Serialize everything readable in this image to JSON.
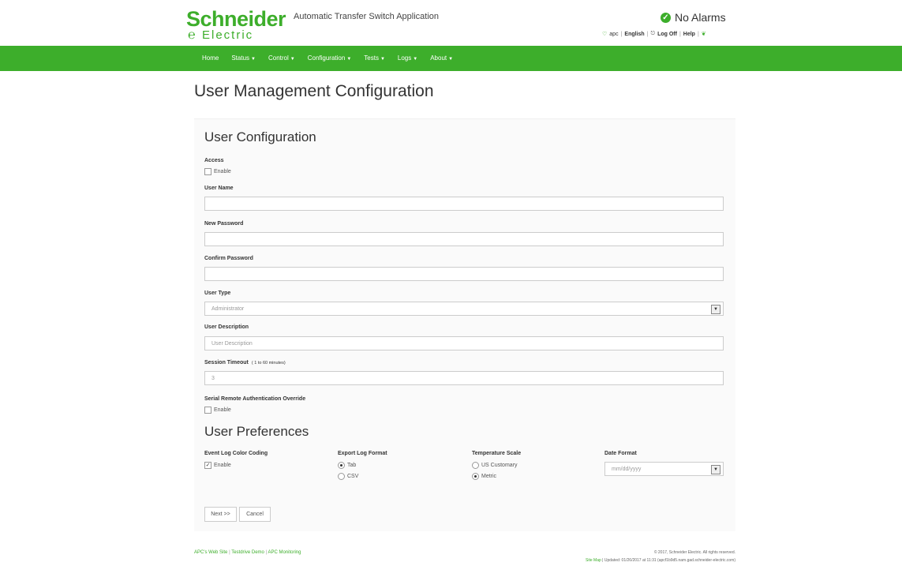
{
  "header": {
    "logo_main": "Schneider",
    "logo_sub": "Electric",
    "app_title": "Automatic Transfer Switch Application",
    "alarm_text": "No Alarms",
    "links": {
      "user": "apc",
      "language": "English",
      "logoff": "Log Off",
      "help": "Help"
    }
  },
  "nav": [
    {
      "label": "Home",
      "dropdown": false
    },
    {
      "label": "Status",
      "dropdown": true
    },
    {
      "label": "Control",
      "dropdown": true
    },
    {
      "label": "Configuration",
      "dropdown": true
    },
    {
      "label": "Tests",
      "dropdown": true
    },
    {
      "label": "Logs",
      "dropdown": true
    },
    {
      "label": "About",
      "dropdown": true
    }
  ],
  "page_title": "User Management Configuration",
  "user_config": {
    "title": "User Configuration",
    "access_label": "Access",
    "access_enable": "Enable",
    "access_checked": false,
    "username_label": "User Name",
    "username_value": "",
    "new_password_label": "New Password",
    "confirm_password_label": "Confirm Password",
    "user_type_label": "User Type",
    "user_type_value": "Administrator",
    "description_label": "User Description",
    "description_placeholder": "User Description",
    "session_timeout_label": "Session Timeout",
    "session_timeout_hint": "( 1 to 60 minutes)",
    "session_timeout_value": "3",
    "serial_override_label": "Serial Remote Authentication Override",
    "serial_override_enable": "Enable",
    "serial_override_checked": false
  },
  "user_prefs": {
    "title": "User Preferences",
    "event_log_label": "Event Log Color Coding",
    "event_log_enable": "Enable",
    "event_log_checked": true,
    "export_label": "Export Log Format",
    "export_options": [
      "Tab",
      "CSV"
    ],
    "export_selected": "Tab",
    "temp_label": "Temperature Scale",
    "temp_options": [
      "US Customary",
      "Metric"
    ],
    "temp_selected": "Metric",
    "date_label": "Date Format",
    "date_value": "mm/dd/yyyy"
  },
  "buttons": {
    "next": "Next >>",
    "cancel": "Cancel"
  },
  "footer": {
    "links": [
      "APC's Web Site",
      "Testdrive Demo",
      "APC Monitoring"
    ],
    "copyright": "© 2017, Schneider Electric. All rights reserved.",
    "site_map": "Site Map",
    "updated": "Updated: 01/26/2017 at 11:31 (apcf1b9d5.nam.gad.schneider-electric.com)"
  },
  "colors": {
    "brand_green": "#3dae2b"
  }
}
